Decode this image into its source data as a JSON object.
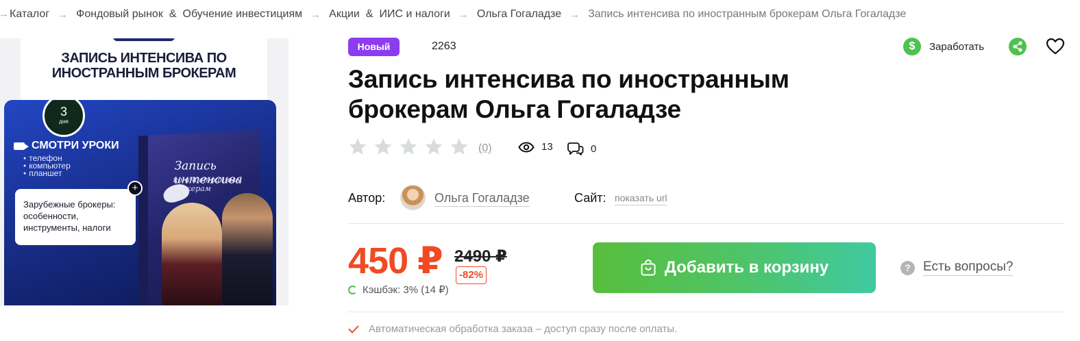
{
  "breadcrumb": {
    "items": [
      {
        "label": "Каталог"
      },
      {
        "label": "Фондовый рынок"
      },
      {
        "label": "Обучение инвестициям"
      },
      {
        "label": "Акции"
      },
      {
        "label": "ИИС и налоги"
      },
      {
        "label": "Ольга Гогаладзе"
      },
      {
        "label": "Запись интенсива по иностранным брокерам Ольга Гогаладзе"
      }
    ],
    "ampersand": "&"
  },
  "image": {
    "top_title": "ЗАПИСЬ ИНТЕНСИВА ПО ИНОСТРАННЫМ БРОКЕРАМ",
    "days_number": "3",
    "days_label": "дня",
    "watch_label": "СМОТРИ УРОКИ",
    "devices": [
      "телефон",
      "компьютер",
      "планшет"
    ],
    "note": "Зарубежные брокеры: особенности, инструменты, налоги",
    "box_title": "Запись интенсива",
    "box_subtitle": "по иностранным брокерам"
  },
  "product": {
    "badge": "Новый",
    "id": "2263",
    "title": "Запись интенсива по иностранным брокерам Ольга Гогаладзе",
    "rating": 0,
    "rating_count": "(0)",
    "views": "13",
    "comments": "0"
  },
  "actions": {
    "earn_label": "Заработать"
  },
  "author": {
    "label": "Автор:",
    "name": "Ольга Гогаладзе",
    "site_label": "Сайт:",
    "site_link": "показать url"
  },
  "pricing": {
    "price": "450 ₽",
    "old_price": "2490 ₽",
    "discount": "-82%",
    "cashback": "Кэшбэк: 3% (14 ₽)"
  },
  "cart": {
    "add_label": "Добавить в корзину",
    "questions_label": "Есть вопросы?"
  },
  "notice": {
    "auto_text": "Автоматическая обработка заказа – доступ сразу после оплаты."
  },
  "colors": {
    "accent_purple": "#8b3cf0",
    "price_orange": "#f04a23",
    "green": "#4fc14f"
  }
}
